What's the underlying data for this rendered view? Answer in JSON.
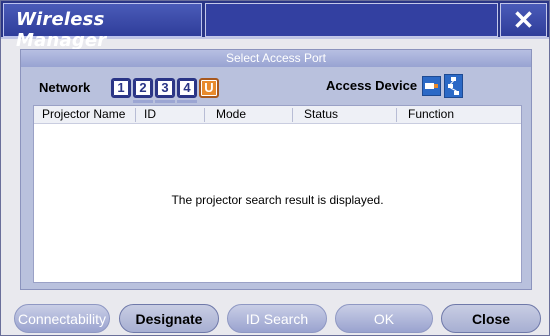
{
  "window": {
    "title": "Wireless Manager",
    "close_symbol": "✕"
  },
  "panel": {
    "header": "Select Access Port"
  },
  "network": {
    "label": "Network",
    "buttons": [
      "1",
      "2",
      "3",
      "4",
      "U"
    ]
  },
  "access_device": {
    "label": "Access Device",
    "icons": [
      "pc-card-icon",
      "network-hub-icon"
    ]
  },
  "table": {
    "columns": [
      "Projector Name",
      "ID",
      "Mode",
      "Status",
      "Function"
    ],
    "empty_message": "The projector search result is displayed."
  },
  "buttons": {
    "connectability": "Connectability",
    "designate": "Designate",
    "id_search": "ID Search",
    "ok": "OK",
    "close": "Close"
  },
  "colors": {
    "title_bar": "#2a3586",
    "accent_orange": "#e88a2c",
    "panel": "#b9c1dd"
  }
}
